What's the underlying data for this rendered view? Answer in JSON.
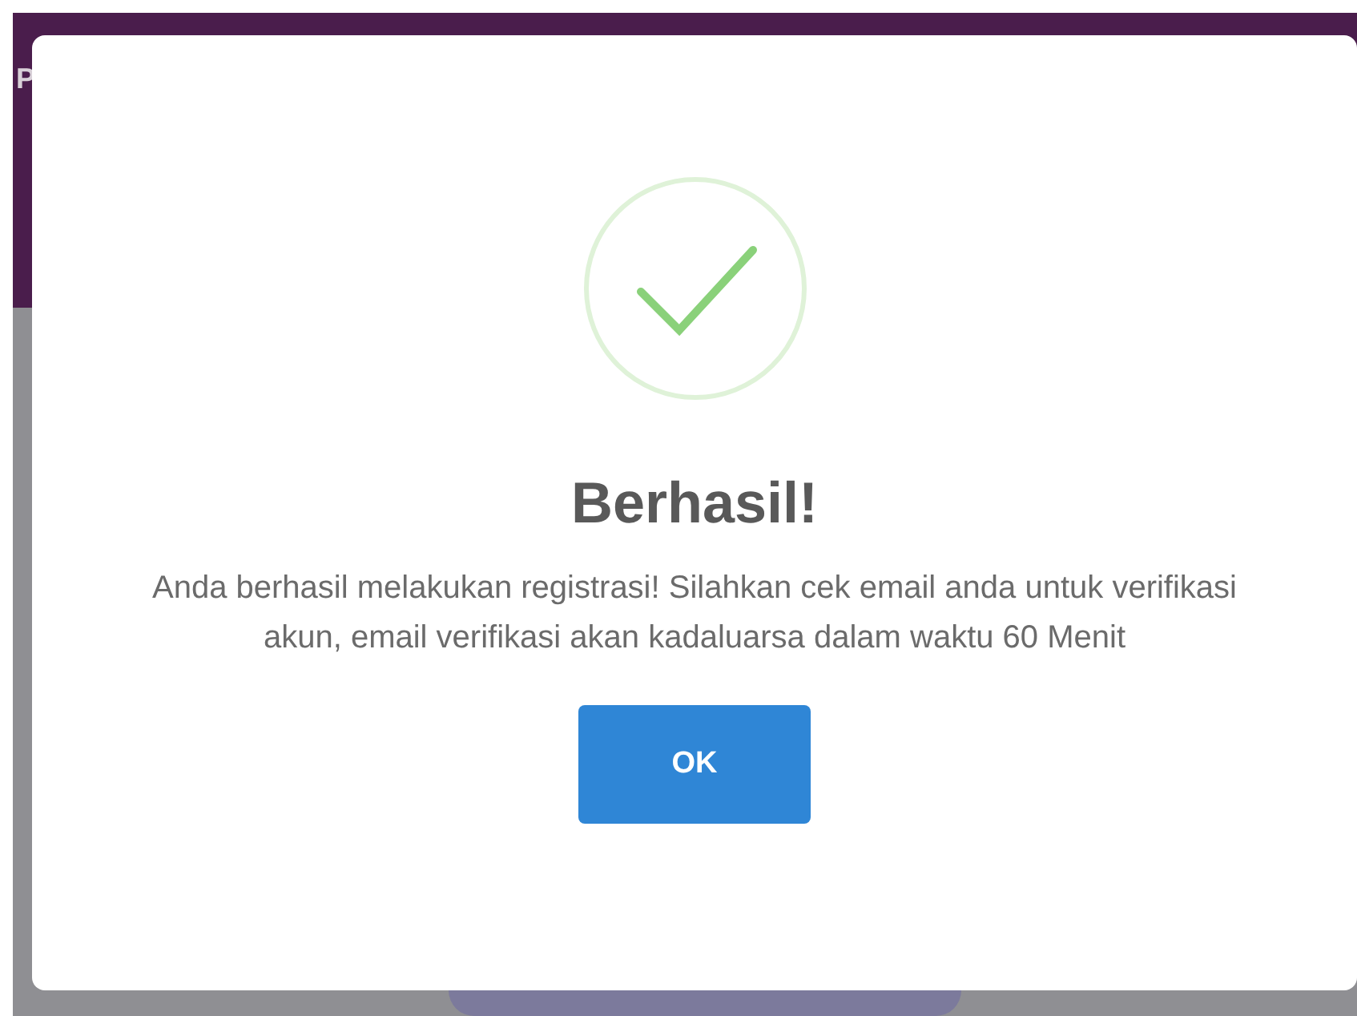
{
  "background": {
    "header_letter": "P"
  },
  "dialog": {
    "title": "Berhasil!",
    "message": "Anda berhasil melakukan registrasi! Silahkan cek email anda untuk verifikasi akun, email verifikasi akan kadaluarsa dalam waktu 60 Menit",
    "button": "OK"
  }
}
